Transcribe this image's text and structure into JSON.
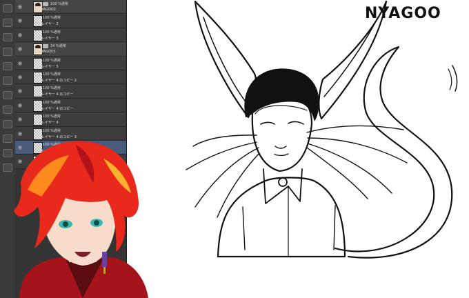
{
  "canvas": {
    "title_text": "NYAGOO"
  },
  "layers": [
    {
      "type": "folder",
      "opacity": "100 %通常",
      "name": "YAGOO2",
      "thumb": "face"
    },
    {
      "type": "layer",
      "opacity": "100 %通常",
      "name": "レイヤー 2",
      "thumb": "blank"
    },
    {
      "type": "layer",
      "opacity": "100 %通常",
      "name": "レイヤー 3",
      "thumb": "blank"
    },
    {
      "type": "folder",
      "opacity": "24 %通常",
      "name": "YAGOO1",
      "thumb": "face"
    },
    {
      "type": "layer",
      "opacity": "100 %通常",
      "name": "レイヤー 5",
      "thumb": "blank"
    },
    {
      "type": "layer",
      "opacity": "100 %通常",
      "name": "レイヤー 4 のコピー 2",
      "thumb": "blank"
    },
    {
      "type": "layer",
      "opacity": "100 %通常",
      "name": "レイヤー 4 のコピー",
      "thumb": "blank"
    },
    {
      "type": "layer",
      "opacity": "100 %通常",
      "name": "レイヤー 4 のコピー",
      "thumb": "blank"
    },
    {
      "type": "layer",
      "opacity": "100 %通常",
      "name": "レイヤー 4",
      "thumb": "blank"
    },
    {
      "type": "layer",
      "opacity": "100 %通常",
      "name": "レイヤー 4 のコピー 3",
      "thumb": "blank"
    },
    {
      "type": "layer",
      "opacity": "100 %通常",
      "name": "レイヤー 7",
      "thumb": "blank",
      "selected": true
    },
    {
      "type": "layer",
      "opacity": "100 %通常",
      "name": "",
      "thumb": "blank"
    }
  ],
  "icons": {
    "eye": "eye-icon",
    "pen": "pen-icon",
    "folder": "folder-icon"
  },
  "colors": {
    "panel_bg": "#343434",
    "selected_row": "#4a5a7a",
    "canvas_bg": "#ffffff",
    "avatar_hair": "#e8291c"
  }
}
